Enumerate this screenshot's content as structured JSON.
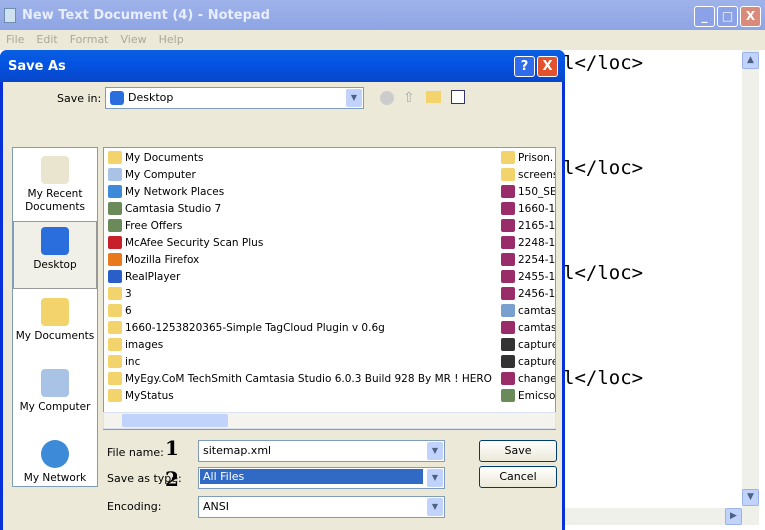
{
  "notepad": {
    "title": "New Text Document (4) - Notepad",
    "menu": [
      "File",
      "Edit",
      "Format",
      "View",
      "Help"
    ],
    "lines": [
      "l</loc>",
      "l</loc>",
      "l</loc>",
      "l</loc>"
    ]
  },
  "dialog": {
    "title": "Save As",
    "save_in_label": "Save in:",
    "save_in_value": "Desktop",
    "places": [
      "My Recent Documents",
      "Desktop",
      "My Documents",
      "My Computer",
      "My Network"
    ],
    "files_col1": [
      {
        "name": "My Documents",
        "icon": "folder-icon"
      },
      {
        "name": "My Computer",
        "icon": "computer-icon"
      },
      {
        "name": "My Network Places",
        "icon": "network-icon"
      },
      {
        "name": "Camtasia Studio 7",
        "icon": "shortcut-icon"
      },
      {
        "name": "Free Offers",
        "icon": "shortcut-icon"
      },
      {
        "name": "McAfee Security Scan Plus",
        "icon": "mcafee-icon"
      },
      {
        "name": "Mozilla Firefox",
        "icon": "firefox-icon"
      },
      {
        "name": "RealPlayer",
        "icon": "realplayer-icon"
      },
      {
        "name": "3",
        "icon": "folder-icon"
      },
      {
        "name": "6",
        "icon": "folder-icon"
      },
      {
        "name": "1660-1253820365-Simple TagCloud Plugin v 0.6g",
        "icon": "folder-icon"
      },
      {
        "name": "images",
        "icon": "folder-icon"
      },
      {
        "name": "inc",
        "icon": "folder-icon"
      },
      {
        "name": "MyEgy.CoM TechSmith Camtasia Studio 6.0.3 Build 928 By MR ! HERO",
        "icon": "folder-icon"
      },
      {
        "name": "MyStatus",
        "icon": "folder-icon"
      }
    ],
    "files_col2": [
      {
        "name": "Prison.",
        "icon": "folder-icon"
      },
      {
        "name": "screens",
        "icon": "folder-icon"
      },
      {
        "name": "150_SE",
        "icon": "archive-icon"
      },
      {
        "name": "1660-1",
        "icon": "archive-icon"
      },
      {
        "name": "2165-1",
        "icon": "archive-icon"
      },
      {
        "name": "2248-1",
        "icon": "archive-icon"
      },
      {
        "name": "2254-1",
        "icon": "archive-icon"
      },
      {
        "name": "2455-1",
        "icon": "archive-icon"
      },
      {
        "name": "2456-1",
        "icon": "archive-icon"
      },
      {
        "name": "camtas",
        "icon": "installer-icon"
      },
      {
        "name": "camtas",
        "icon": "archive-icon"
      },
      {
        "name": "capture",
        "icon": "video-icon"
      },
      {
        "name": "capture",
        "icon": "video-icon"
      },
      {
        "name": "change",
        "icon": "archive-icon"
      },
      {
        "name": "Emicsol",
        "icon": "shortcut-icon"
      }
    ],
    "file_name_label": "File name:",
    "file_name_value": "sitemap.xml",
    "save_type_label": "Save as type:",
    "save_type_value": "All Files",
    "encoding_label": "Encoding:",
    "encoding_value": "ANSI",
    "save_button": "Save",
    "cancel_button": "Cancel",
    "annotations": [
      "1",
      "2"
    ]
  },
  "colors": {
    "folder": "#f3d36b",
    "archive": "#9b2c6a",
    "selection": "#316ac5",
    "title_active": "#0454e4"
  }
}
